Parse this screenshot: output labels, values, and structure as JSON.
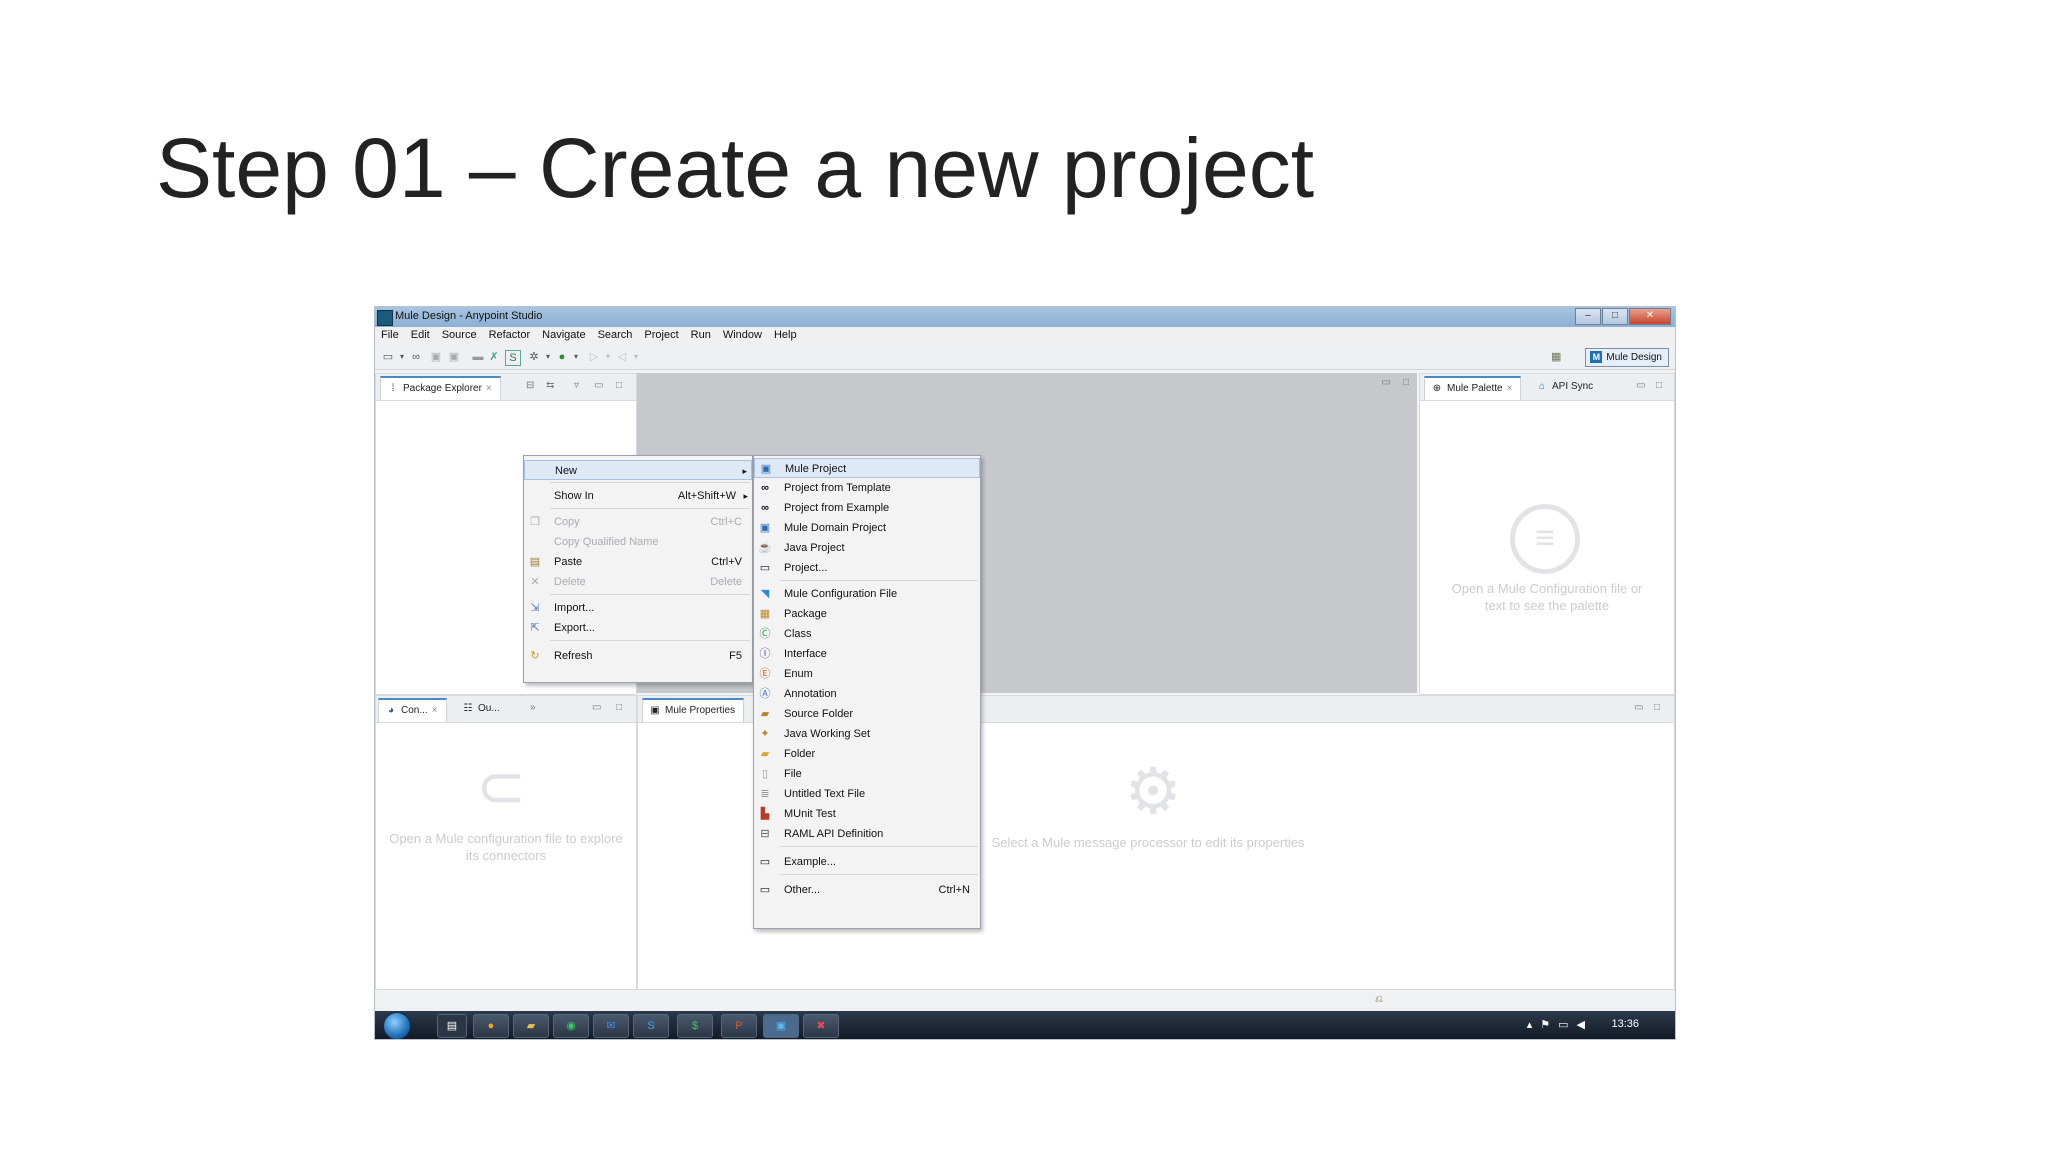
{
  "slide": {
    "title": "Step 01 – Create a new project"
  },
  "window": {
    "title": "Mule Design - Anypoint Studio",
    "buttons": [
      "–",
      "□",
      "✕"
    ]
  },
  "menubar": [
    "File",
    "Edit",
    "Source",
    "Refactor",
    "Navigate",
    "Search",
    "Project",
    "Run",
    "Window",
    "Help"
  ],
  "toolbar": {
    "perspective_label": "Mule Design"
  },
  "left_panel": {
    "tab_label": "Package Explorer"
  },
  "right_panel": {
    "tab1": "Mule Palette",
    "tab2": "API Sync",
    "hint": "Open a Mule Configuration file or text to see the palette"
  },
  "bottom_left": {
    "tab1": "Con...",
    "tab2": "Ou...",
    "hint": "Open a Mule configuration file to explore its connectors"
  },
  "bottom_center": {
    "tab": "Mule Properties",
    "hint": "Select a Mule message processor to edit its properties"
  },
  "context_menu": {
    "items": [
      {
        "label": "New",
        "shortcut": "",
        "icon": "",
        "disabled": false,
        "submenu": true
      },
      {
        "label": "Show In",
        "shortcut": "Alt+Shift+W",
        "icon": "",
        "disabled": false,
        "submenu": true
      },
      {
        "label": "Copy",
        "shortcut": "Ctrl+C",
        "icon": "copy-icon",
        "disabled": true
      },
      {
        "label": "Copy Qualified Name",
        "shortcut": "",
        "icon": "",
        "disabled": true
      },
      {
        "label": "Paste",
        "shortcut": "Ctrl+V",
        "icon": "paste-icon",
        "disabled": false
      },
      {
        "label": "Delete",
        "shortcut": "Delete",
        "icon": "delete-icon",
        "disabled": true
      },
      {
        "label": "Import...",
        "shortcut": "",
        "icon": "import-icon",
        "disabled": false
      },
      {
        "label": "Export...",
        "shortcut": "",
        "icon": "export-icon",
        "disabled": false
      },
      {
        "label": "Refresh",
        "shortcut": "F5",
        "icon": "refresh-icon",
        "disabled": false
      }
    ]
  },
  "submenu": {
    "items": [
      {
        "label": "Mule Project",
        "shortcut": ""
      },
      {
        "label": "Project from Template",
        "shortcut": ""
      },
      {
        "label": "Project from Example",
        "shortcut": ""
      },
      {
        "label": "Mule Domain Project",
        "shortcut": ""
      },
      {
        "label": "Java Project",
        "shortcut": ""
      },
      {
        "label": "Project...",
        "shortcut": ""
      },
      {
        "label": "Mule Configuration File",
        "shortcut": ""
      },
      {
        "label": "Package",
        "shortcut": ""
      },
      {
        "label": "Class",
        "shortcut": ""
      },
      {
        "label": "Interface",
        "shortcut": ""
      },
      {
        "label": "Enum",
        "shortcut": ""
      },
      {
        "label": "Annotation",
        "shortcut": ""
      },
      {
        "label": "Source Folder",
        "shortcut": ""
      },
      {
        "label": "Java Working Set",
        "shortcut": ""
      },
      {
        "label": "Folder",
        "shortcut": ""
      },
      {
        "label": "File",
        "shortcut": ""
      },
      {
        "label": "Untitled Text File",
        "shortcut": ""
      },
      {
        "label": "MUnit Test",
        "shortcut": ""
      },
      {
        "label": "RAML API Definition",
        "shortcut": ""
      },
      {
        "label": "Example...",
        "shortcut": ""
      },
      {
        "label": "Other...",
        "shortcut": "Ctrl+N"
      }
    ]
  },
  "taskbar": {
    "clock": "13:36"
  }
}
